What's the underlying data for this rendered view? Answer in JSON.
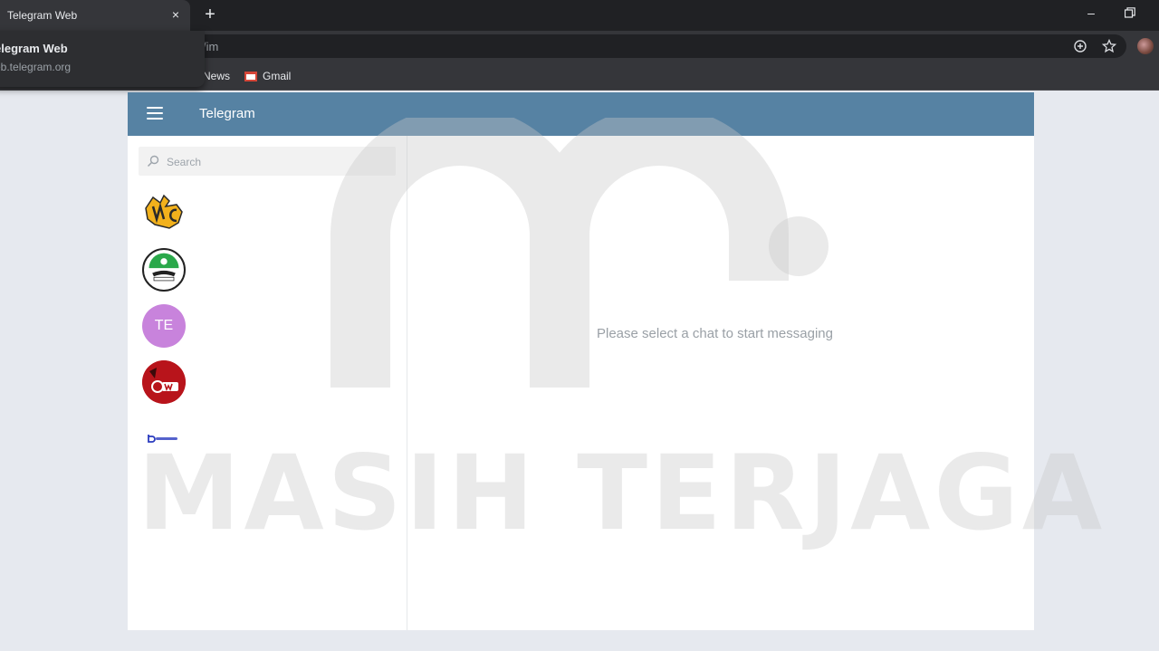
{
  "browser": {
    "tab_title": "Telegram Web",
    "tab_close": "×",
    "new_tab": "+",
    "minimize": "–",
    "url_path": "/im",
    "bookmarks": [
      {
        "label": "News"
      },
      {
        "label": "Gmail"
      }
    ],
    "tab_hover_card": {
      "title": "elegram Web",
      "url": "eb.telegram.org"
    }
  },
  "app": {
    "title": "Telegram",
    "header_color": "#5682a3",
    "search_placeholder": "Search",
    "chats": [
      {
        "avatar": "logo-nc"
      },
      {
        "avatar": "logo-green-emblem"
      },
      {
        "avatar_initials": "TE",
        "color": "#c883dc"
      },
      {
        "avatar": "logo-red-3w"
      },
      {
        "avatar": "logo-blue-text"
      }
    ],
    "empty_state": "Please select a chat to start messaging"
  },
  "watermark": {
    "text": "MASIH TERJAGA"
  }
}
